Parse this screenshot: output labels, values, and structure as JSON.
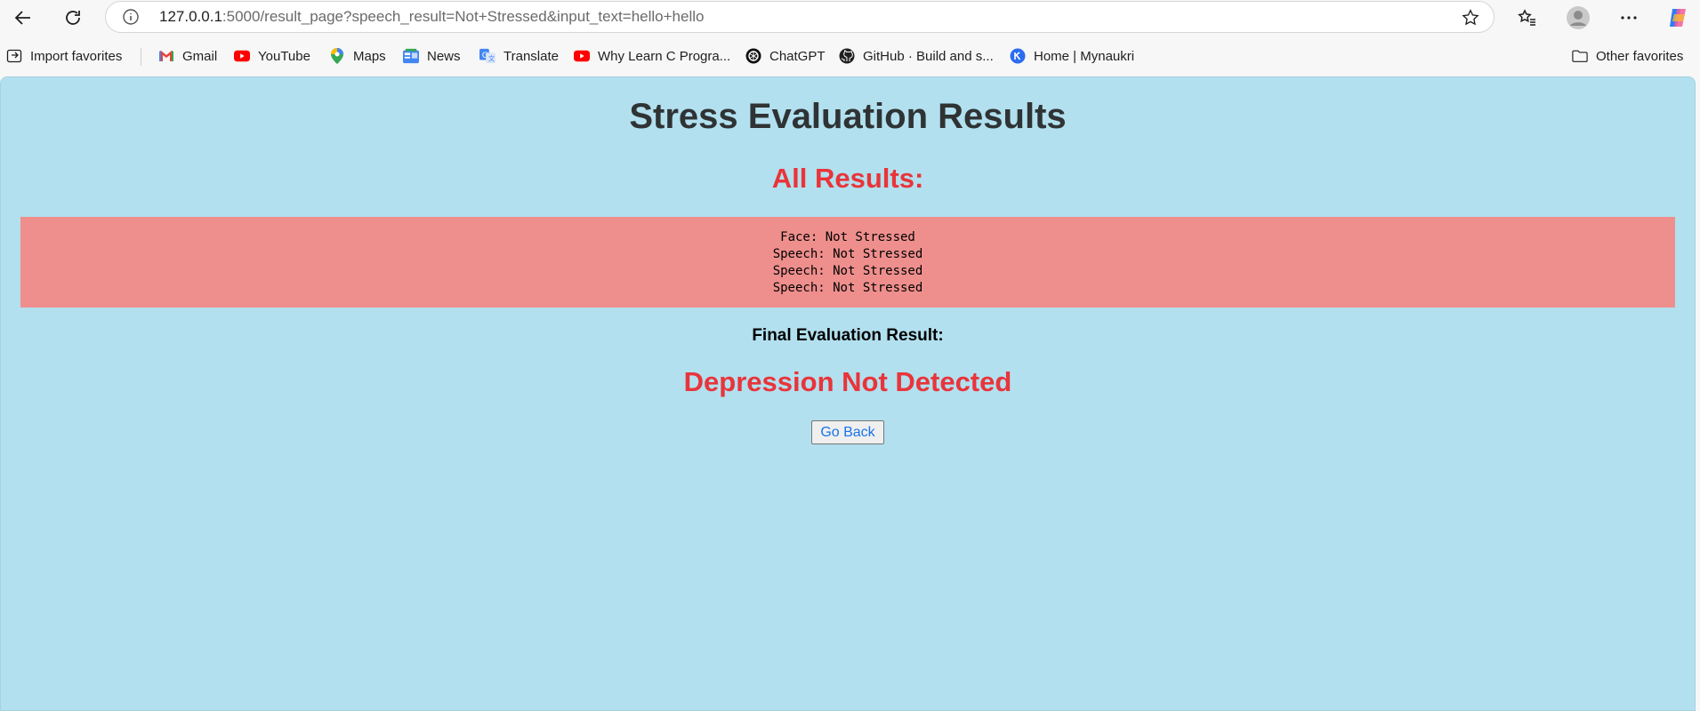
{
  "browser": {
    "url_host": "127.0.0.1",
    "url_rest": ":5000/result_page?speech_result=Not+Stressed&input_text=hello+hello"
  },
  "bookmarks": {
    "import": "Import favorites",
    "items": [
      {
        "label": "Gmail",
        "icon": "gmail-icon"
      },
      {
        "label": "YouTube",
        "icon": "youtube-icon"
      },
      {
        "label": "Maps",
        "icon": "maps-icon"
      },
      {
        "label": "News",
        "icon": "news-icon"
      },
      {
        "label": "Translate",
        "icon": "translate-icon"
      },
      {
        "label": "Why Learn C Progra...",
        "icon": "youtube-icon"
      },
      {
        "label": "ChatGPT",
        "icon": "chatgpt-icon"
      },
      {
        "label": "GitHub · Build and s...",
        "icon": "github-icon"
      },
      {
        "label": "Home | Mynaukri",
        "icon": "mynaukri-icon"
      }
    ],
    "other": "Other favorites"
  },
  "page": {
    "title": "Stress Evaluation Results",
    "all_results_heading": "All Results:",
    "results": [
      "Face: Not Stressed",
      "Speech: Not Stressed",
      "Speech: Not Stressed",
      "Speech: Not Stressed"
    ],
    "final_label": "Final Evaluation Result:",
    "final_value": "Depression Not Detected",
    "go_back": "Go Back"
  },
  "colors": {
    "page_background": "#b2e0ef",
    "heading_accent": "#e9343a",
    "results_box": "#ee8f8d"
  }
}
